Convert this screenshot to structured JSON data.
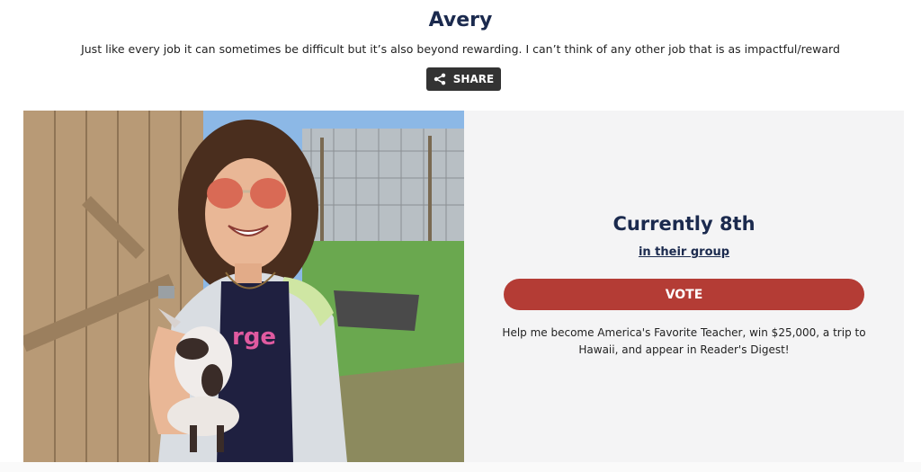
{
  "profile": {
    "name": "Avery",
    "bio": "Just like every job it can sometimes be difficult but it’s also beyond rewarding. I can’t think of any other job that is as impactful/reward"
  },
  "share": {
    "label": "SHARE",
    "icon": "share-icon"
  },
  "photo": {
    "subject": "teacher-holding-baby-goat"
  },
  "ranking": {
    "position_text": "Currently 8th",
    "group_link_text": "in their group"
  },
  "vote": {
    "label": "VOTE"
  },
  "pitch": {
    "text": "Help me become America's Favorite Teacher, win $25,000, a trip to Hawaii, and appear in Reader's Digest!"
  },
  "colors": {
    "navy": "#1b2a4e",
    "vote_red": "#b43c35",
    "share_dark": "#333333",
    "panel_bg": "#f4f4f5"
  }
}
